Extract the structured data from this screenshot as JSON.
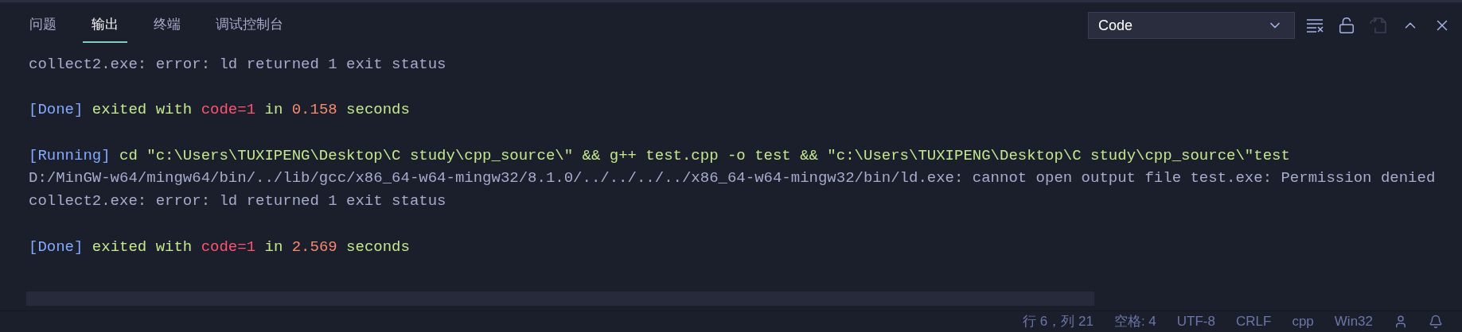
{
  "tabs": [
    {
      "label": "问题",
      "selected": false
    },
    {
      "label": "输出",
      "selected": true
    },
    {
      "label": "终端",
      "selected": false
    },
    {
      "label": "调试控制台",
      "selected": false
    }
  ],
  "channel_select": {
    "value": "Code"
  },
  "actions": [
    {
      "kind": "clear",
      "disabled": false
    },
    {
      "kind": "lock",
      "disabled": false
    },
    {
      "kind": "open-file",
      "disabled": true
    },
    {
      "kind": "maximize",
      "disabled": false
    },
    {
      "kind": "close",
      "disabled": false
    }
  ],
  "output": [
    {
      "segments": [
        {
          "kind": "plain",
          "text": "collect2.exe: error: ld returned 1 exit status"
        }
      ]
    },
    {
      "gap_before": true,
      "segments": [
        {
          "kind": "tag",
          "text": "[Done]"
        },
        {
          "kind": "string",
          "text": " exited with "
        },
        {
          "kind": "error",
          "text": "code=1"
        },
        {
          "kind": "string",
          "text": " in "
        },
        {
          "kind": "number",
          "text": "0.158"
        },
        {
          "kind": "string",
          "text": " seconds"
        }
      ]
    },
    {
      "gap_before": true,
      "segments": [
        {
          "kind": "tag",
          "text": "[Running]"
        },
        {
          "kind": "string",
          "text": " cd \"c:\\Users\\TUXIPENG\\Desktop\\C study\\cpp_source\\\" && g++ test.cpp -o test && \"c:\\Users\\TUXIPENG\\Desktop\\C study\\cpp_source\\\"test"
        }
      ]
    },
    {
      "segments": [
        {
          "kind": "plain",
          "text": "D:/MinGW-w64/mingw64/bin/../lib/gcc/x86_64-w64-mingw32/8.1.0/../../../../x86_64-w64-mingw32/bin/ld.exe: cannot open output file test.exe: Permission denied"
        }
      ]
    },
    {
      "segments": [
        {
          "kind": "plain",
          "text": "collect2.exe: error: ld returned 1 exit status"
        }
      ]
    },
    {
      "gap_before": true,
      "segments": [
        {
          "kind": "tag",
          "text": "[Done]"
        },
        {
          "kind": "string",
          "text": " exited with "
        },
        {
          "kind": "error",
          "text": "code=1"
        },
        {
          "kind": "string",
          "text": " in "
        },
        {
          "kind": "number",
          "text": "2.569"
        },
        {
          "kind": "string",
          "text": " seconds"
        }
      ]
    }
  ],
  "status_bar": [
    "行 6，列 21",
    "空格: 4",
    "UTF-8",
    "CRLF",
    "cpp",
    "Win32"
  ]
}
